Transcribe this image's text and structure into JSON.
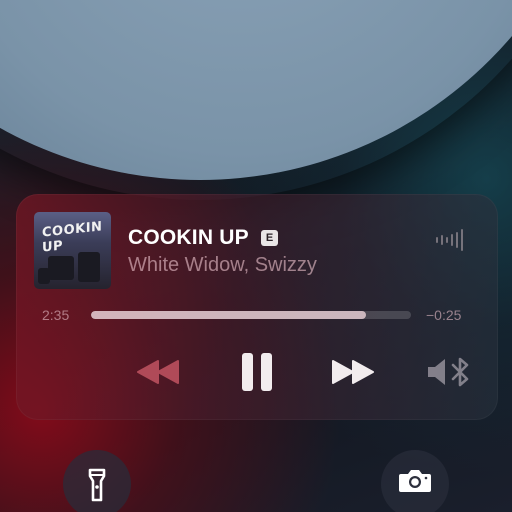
{
  "now_playing": {
    "artwork_text": "COOKIN UP",
    "title": "COOKIN UP",
    "explicit_badge": "E",
    "artist": "White Widow, Swizzy",
    "elapsed": "2:35",
    "remaining": "−0:25",
    "progress": 0.86,
    "state": "playing"
  },
  "controls": {
    "rewind_icon": "rewind-icon",
    "pause_icon": "pause-icon",
    "forward_icon": "fast-forward-icon",
    "audio_output_icon": "speaker-bluetooth-icon",
    "waveform_icon": "waveform-icon"
  },
  "quick_actions": {
    "left_icon": "flashlight-icon",
    "right_icon": "camera-icon"
  },
  "colors": {
    "accent_red": "#8c1a26",
    "text_primary": "#ffffff",
    "text_secondary": "#e6bec8",
    "rewind_tint": "#b04a58"
  }
}
